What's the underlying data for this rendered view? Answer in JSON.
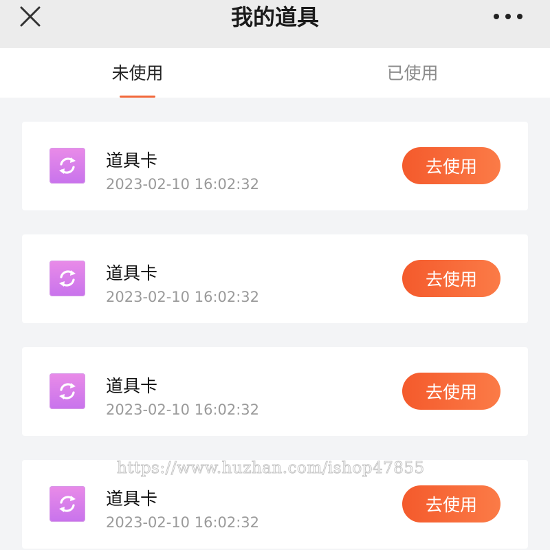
{
  "header": {
    "title": "我的道具",
    "close_icon": "close-icon",
    "more_icon": "more-horizontal-icon"
  },
  "tabs": [
    {
      "label": "未使用",
      "active": true
    },
    {
      "label": "已使用",
      "active": false
    }
  ],
  "colors": {
    "accent": "#f2683b",
    "button_start": "#f45a2c",
    "button_end": "#fb7b47",
    "icon_start": "#e98be8",
    "icon_end": "#c873ec"
  },
  "items": [
    {
      "icon": "refresh-card-icon",
      "title": "道具卡",
      "time": "2023-02-10 16:02:32",
      "action": "去使用"
    },
    {
      "icon": "refresh-card-icon",
      "title": "道具卡",
      "time": "2023-02-10 16:02:32",
      "action": "去使用"
    },
    {
      "icon": "refresh-card-icon",
      "title": "道具卡",
      "time": "2023-02-10 16:02:32",
      "action": "去使用"
    },
    {
      "icon": "refresh-card-icon",
      "title": "道具卡",
      "time": "2023-02-10 16:02:32",
      "action": "去使用"
    }
  ],
  "watermark": "https://www.huzhan.com/ishop47855"
}
